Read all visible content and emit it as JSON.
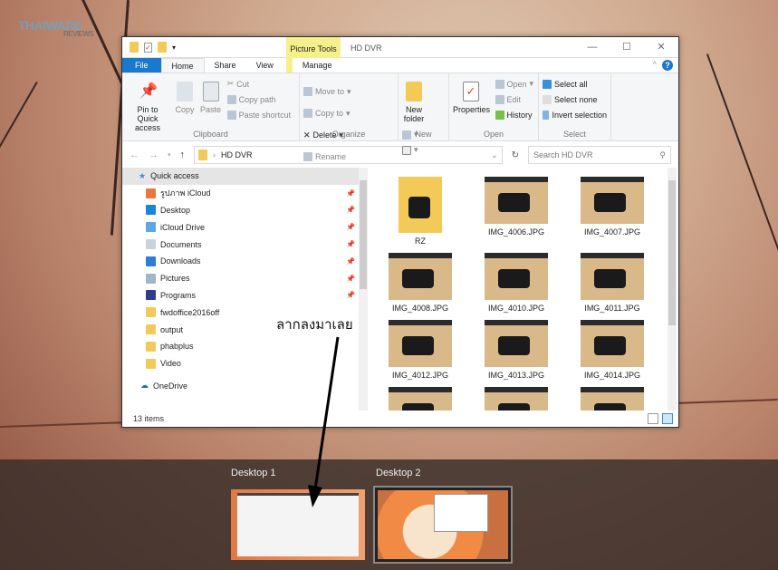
{
  "watermark": {
    "brand": "THAIWARE",
    "sub": "REVIEWS"
  },
  "window": {
    "title": "HD DVR",
    "contextual_tab": "Picture Tools",
    "controls": [
      "—",
      "☐",
      "✕"
    ]
  },
  "tabs": [
    "File",
    "Home",
    "Share",
    "View",
    "Manage"
  ],
  "ribbon": {
    "clipboard": {
      "label": "Clipboard",
      "pin": "Pin to Quick access",
      "copy": "Copy",
      "paste": "Paste",
      "cut": "Cut",
      "copy_path": "Copy path",
      "paste_shortcut": "Paste shortcut"
    },
    "organize": {
      "label": "Organize",
      "move_to": "Move to",
      "copy_to": "Copy to",
      "delete": "Delete",
      "rename": "Rename"
    },
    "new": {
      "label": "New",
      "new_folder": "New folder"
    },
    "open": {
      "label": "Open",
      "properties": "Properties",
      "open": "Open",
      "edit": "Edit",
      "history": "History"
    },
    "select": {
      "label": "Select",
      "select_all": "Select all",
      "select_none": "Select none",
      "invert": "Invert selection"
    }
  },
  "address": {
    "path": "HD DVR",
    "search_placeholder": "Search HD DVR"
  },
  "nav": {
    "quick_access": "Quick access",
    "items": [
      {
        "label": "รูปภาพ iCloud",
        "pinned": true,
        "color": "#e9763d"
      },
      {
        "label": "Desktop",
        "pinned": true,
        "color": "#1a86d8"
      },
      {
        "label": "iCloud Drive",
        "pinned": true,
        "color": "#5aa8e6"
      },
      {
        "label": "Documents",
        "pinned": true,
        "color": "#c8d3df"
      },
      {
        "label": "Downloads",
        "pinned": true,
        "color": "#2a7fd4"
      },
      {
        "label": "Pictures",
        "pinned": true,
        "color": "#9fb6cc"
      },
      {
        "label": "Programs",
        "pinned": true,
        "color": "#2b3e8a"
      },
      {
        "label": "fwdoffice2016off",
        "pinned": false,
        "color": "#f3c957"
      },
      {
        "label": "output",
        "pinned": false,
        "color": "#f3c957"
      },
      {
        "label": "phabplus",
        "pinned": false,
        "color": "#f3c957"
      },
      {
        "label": "Video",
        "pinned": false,
        "color": "#f3c957"
      }
    ],
    "onedrive": "OneDrive"
  },
  "files": [
    "RZ",
    "IMG_4006.JPG",
    "IMG_4007.JPG",
    "IMG_4008.JPG",
    "IMG_4010.JPG",
    "IMG_4011.JPG",
    "IMG_4012.JPG",
    "IMG_4013.JPG",
    "IMG_4014.JPG"
  ],
  "status": "13 items",
  "annotation": "ลากลงมาเลย",
  "desktops": [
    "Desktop 1",
    "Desktop 2"
  ]
}
